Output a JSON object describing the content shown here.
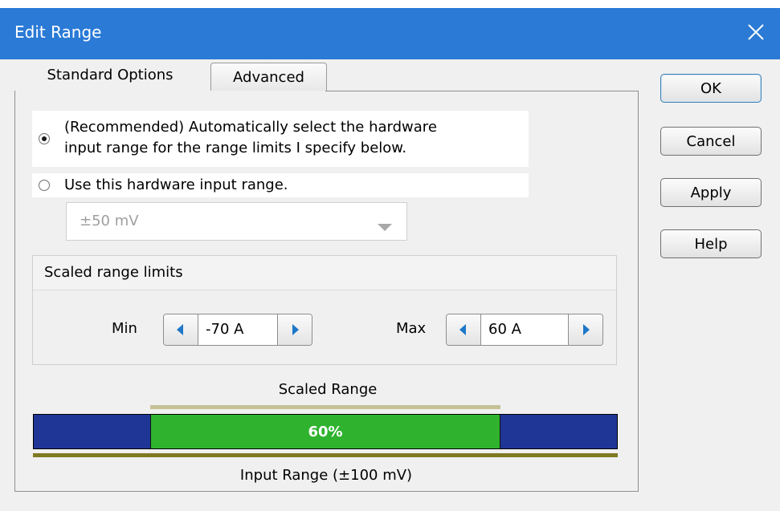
{
  "window": {
    "title": "Edit Range"
  },
  "tabs": [
    {
      "label": "Standard Options",
      "active": true
    },
    {
      "label": "Advanced",
      "active": false
    }
  ],
  "options": {
    "auto": {
      "line1": "(Recommended) Automatically select the hardware",
      "line2": "input range for the range limits I specify below.",
      "checked": true
    },
    "manual": {
      "label": "Use this hardware input range.",
      "checked": false
    }
  },
  "hardware_range": {
    "value": "±50 mV",
    "disabled": true
  },
  "limits": {
    "group_label": "Scaled range limits",
    "min_label": "Min",
    "min_value": "-70 A",
    "max_label": "Max",
    "max_value": "60 A"
  },
  "range_bar": {
    "scaled_label": "Scaled Range",
    "percent_text": "60%",
    "fill_fraction": 0.6,
    "input_label": "Input Range (±100 mV)"
  },
  "buttons": {
    "ok": "OK",
    "cancel": "Cancel",
    "apply": "Apply",
    "help": "Help"
  },
  "colors": {
    "title_bar": "#2a7ad6",
    "bar_input": "#1f3696",
    "bar_scaled": "#2fb32f",
    "spin_arrow": "#1e78c8"
  }
}
